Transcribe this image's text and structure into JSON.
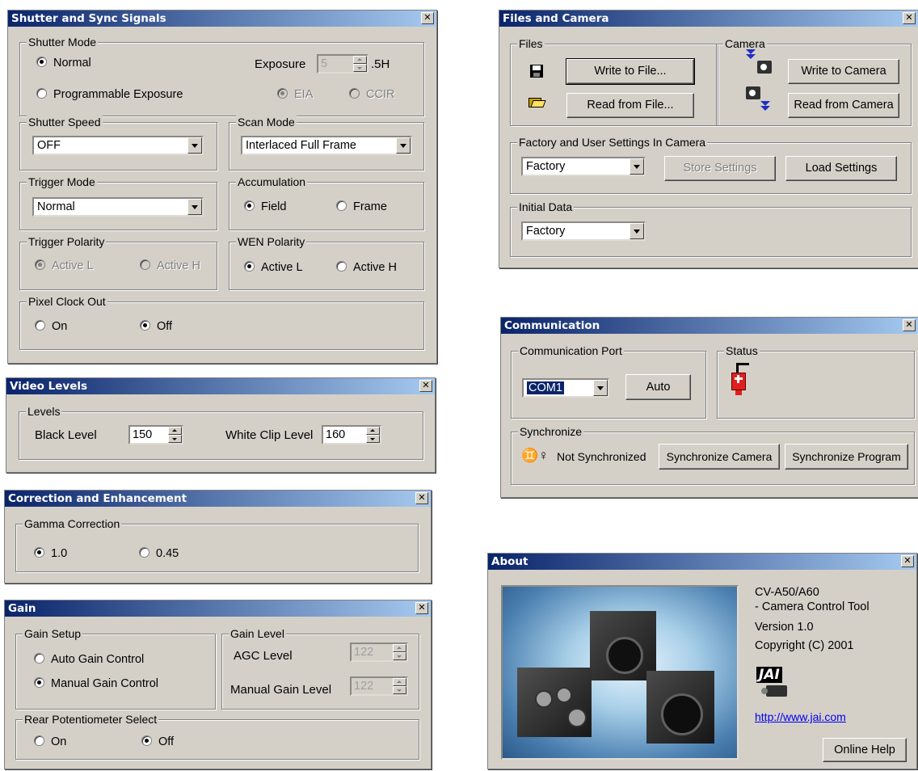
{
  "shutter": {
    "title": "Shutter and Sync Signals",
    "close": "✕",
    "mode_label": "Shutter Mode",
    "normal": "Normal",
    "programmable": "Programmable Exposure",
    "exposure_label": "Exposure",
    "exposure_value": "5",
    "exposure_unit": ".5H",
    "eia": "EIA",
    "ccir": "CCIR",
    "speed_label": "Shutter Speed",
    "speed_value": "OFF",
    "scan_label": "Scan Mode",
    "scan_value": "Interlaced Full Frame",
    "trigger_mode_label": "Trigger Mode",
    "trigger_mode_value": "Normal",
    "accum_label": "Accumulation",
    "field": "Field",
    "frame": "Frame",
    "trig_pol_label": "Trigger Polarity",
    "trig_active_l": "Active L",
    "trig_active_h": "Active H",
    "wen_label": "WEN Polarity",
    "wen_active_l": "Active L",
    "wen_active_h": "Active H",
    "pixel_label": "Pixel Clock Out",
    "pixel_on": "On",
    "pixel_off": "Off"
  },
  "video": {
    "title": "Video Levels",
    "levels_label": "Levels",
    "black_label": "Black Level",
    "black_value": "150",
    "white_label": "White Clip Level",
    "white_value": "160"
  },
  "correction": {
    "title": "Correction and Enhancement",
    "gamma_label": "Gamma Correction",
    "g1": "1.0",
    "g2": "0.45"
  },
  "gain": {
    "title": "Gain",
    "setup_label": "Gain Setup",
    "auto": "Auto Gain Control",
    "manual": "Manual Gain Control",
    "level_label": "Gain Level",
    "agc_label": "AGC Level",
    "agc_value": "122",
    "manual_label": "Manual Gain Level",
    "manual_value": "122",
    "rear_label": "Rear Potentiometer Select",
    "rear_on": "On",
    "rear_off": "Off"
  },
  "files": {
    "title": "Files and Camera",
    "files_label": "Files",
    "write_file": "Write to File...",
    "read_file": "Read from File...",
    "camera_label": "Camera",
    "write_camera": "Write to Camera",
    "read_camera": "Read from Camera",
    "factory_label": "Factory and User Settings In Camera",
    "factory_value": "Factory",
    "store": "Store Settings",
    "load": "Load Settings",
    "initial_label": "Initial Data",
    "initial_value": "Factory"
  },
  "comm": {
    "title": "Communication",
    "port_label": "Communication Port",
    "port_value": "COM1",
    "auto": "Auto",
    "status_label": "Status",
    "sync_label": "Synchronize",
    "not_sync": "Not Synchronized",
    "sync_camera": "Synchronize Camera",
    "sync_program": "Synchronize Program"
  },
  "about": {
    "title": "About",
    "product": "CV-A50/A60",
    "subtitle": "- Camera Control Tool",
    "version": "Version 1.0",
    "copyright": "Copyright (C) 2001",
    "logo": "JAI",
    "url": "http://www.jai.com",
    "help": "Online Help"
  },
  "colors": {
    "title_gradient_start": "#0a246a",
    "title_gradient_end": "#a6caf0",
    "face": "#d4d0c8"
  }
}
